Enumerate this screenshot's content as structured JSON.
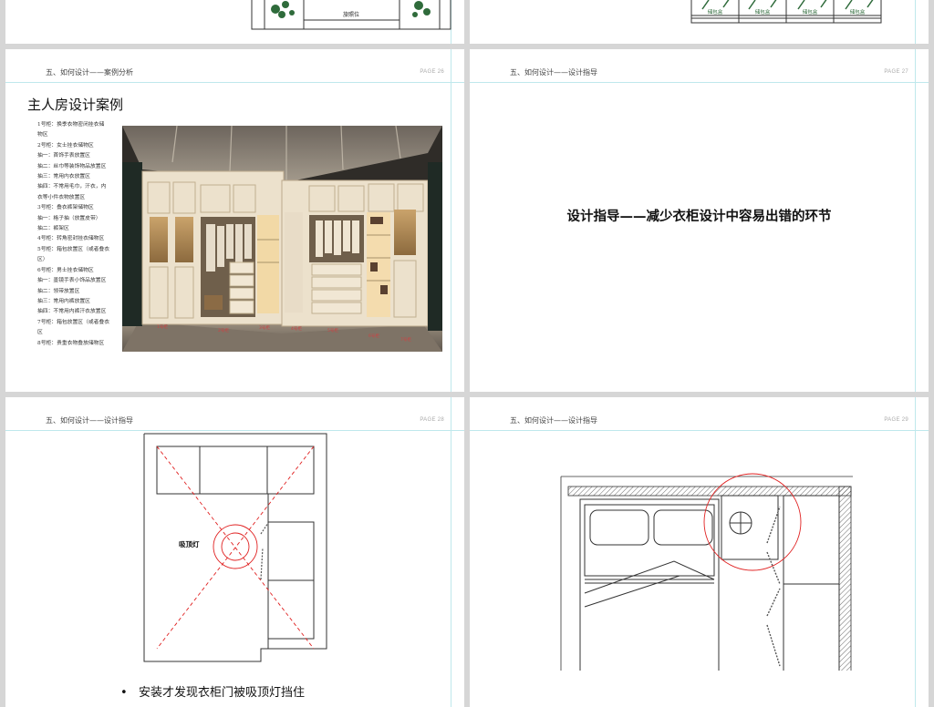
{
  "top_slides": {
    "left_label": "旅照位",
    "right_labels": [
      "储包盒",
      "储包盒",
      "储包盒",
      "储包盒"
    ]
  },
  "slide26": {
    "header": "五、如何设计——案例分析",
    "page": "PAGE 26",
    "title": "主人房设计案例",
    "notes": [
      "1号柜：换季衣物密闭挂衣储",
      "物区",
      "2号柜：女士挂衣储物区",
      "抽一：首饰手表放置区",
      "抽二：丝巾等装饰物品放置区",
      "抽三：常用内衣放置区",
      "抽四：不常用毛巾，汗衣，内",
      "衣等小件衣物放置区",
      "3号柜：叠衣裤架储物区",
      "抽一：格子抽（放置皮带）",
      "抽二：裤架区",
      "4号柜：转角密封挂衣储物区",
      "5号柜：箱包放置区（或者叠衣",
      "区）",
      "6号柜：男士挂衣储物区",
      "抽一：墨镜手表小饰品放置区",
      "抽二：领带放置区",
      "抽三：常用内裤放置区",
      "抽四：不常用内裤汗衣放置区",
      "7号柜：箱包放置区（或者叠衣",
      "区",
      "8号柜：贵重衣物叠放储物区"
    ],
    "photo_labels": [
      "1号柜",
      "2号柜",
      "3号柜",
      "4号柜",
      "5号柜",
      "6号柜",
      "7号柜"
    ]
  },
  "slide27": {
    "header": "五、如何设计——设计指导",
    "page": "PAGE 27",
    "title": "设计指导——减少衣柜设计中容易出错的环节"
  },
  "slide28": {
    "header": "五、如何设计——设计指导",
    "page": "PAGE 28",
    "lamp_label": "吸顶灯",
    "bullet": "安装才发现衣柜门被吸顶灯挡住"
  },
  "slide29": {
    "header": "五、如何设计——设计指导",
    "page": "PAGE 29"
  },
  "colors": {
    "guide_line": "#bfe8ec",
    "drawing_red": "#e02020",
    "panel_cream": "#ece1cc",
    "icon_green": "#2f6b3b"
  }
}
